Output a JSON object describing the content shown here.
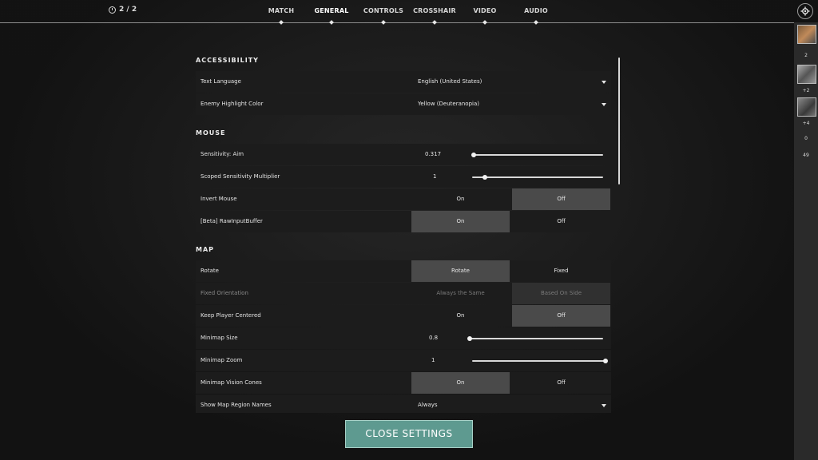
{
  "topbar": {
    "counter": "2 / 2",
    "tabs": [
      {
        "label": "MATCH"
      },
      {
        "label": "GENERAL"
      },
      {
        "label": "CONTROLS"
      },
      {
        "label": "CROSSHAIR"
      },
      {
        "label": "VIDEO"
      },
      {
        "label": "AUDIO"
      }
    ],
    "active_tab": "GENERAL"
  },
  "right_panel": {
    "count_top": "2",
    "badge_1": "+2",
    "badge_2": "+4",
    "count_a": "0",
    "count_b": "49"
  },
  "sections": {
    "accessibility": "ACCESSIBILITY",
    "mouse": "MOUSE",
    "map": "MAP"
  },
  "settings": {
    "text_language": {
      "label": "Text Language",
      "value": "English (United States)"
    },
    "enemy_highlight": {
      "label": "Enemy Highlight Color",
      "value": "Yellow (Deuteranopia)"
    },
    "sensitivity_aim": {
      "label": "Sensitivity: Aim",
      "value": "0.317",
      "fraction": 0.0
    },
    "scoped_sens": {
      "label": "Scoped Sensitivity Multiplier",
      "value": "1",
      "fraction": 0.1
    },
    "invert_mouse": {
      "label": "Invert Mouse",
      "opt_on": "On",
      "opt_off": "Off",
      "selected": "Off"
    },
    "raw_input": {
      "label": "[Beta] RawInputBuffer",
      "opt_on": "On",
      "opt_off": "Off",
      "selected": "On"
    },
    "rotate": {
      "label": "Rotate",
      "opt_a": "Rotate",
      "opt_b": "Fixed",
      "selected": "Rotate"
    },
    "fixed_orientation": {
      "label": "Fixed Orientation",
      "opt_a": "Always the Same",
      "opt_b": "Based On Side",
      "selected": "Based On Side"
    },
    "keep_centered": {
      "label": "Keep Player Centered",
      "opt_on": "On",
      "opt_off": "Off",
      "selected": "Off"
    },
    "minimap_size": {
      "label": "Minimap Size",
      "value": "0.8",
      "fraction": 0.0
    },
    "minimap_zoom": {
      "label": "Minimap Zoom",
      "value": "1",
      "fraction": 1.0
    },
    "vision_cones": {
      "label": "Minimap Vision Cones",
      "opt_on": "On",
      "opt_off": "Off",
      "selected": "On"
    },
    "region_names": {
      "label": "Show Map Region Names",
      "value": "Always"
    }
  },
  "close_button": "CLOSE SETTINGS",
  "colors": {
    "accent": "#5e9a90",
    "selected": "#4a4a4a"
  }
}
